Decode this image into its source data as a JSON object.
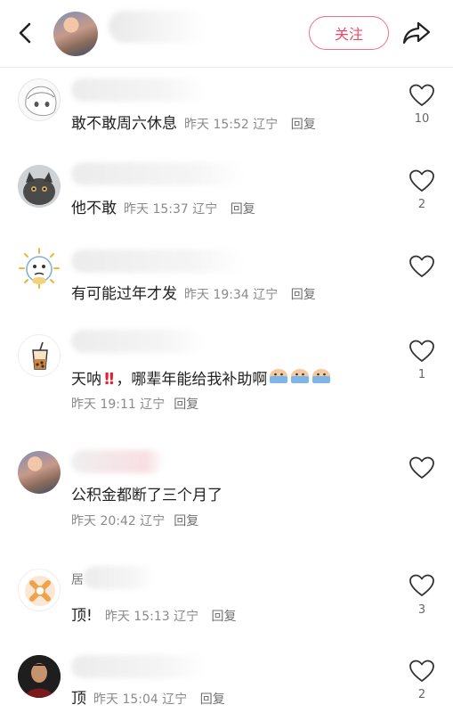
{
  "header": {
    "follow_label": "关注"
  },
  "comments": [
    {
      "text": "敢不敢周六休息",
      "date": "昨天",
      "time": "15:52",
      "location": "辽宁",
      "reply": "回复",
      "likes": "10"
    },
    {
      "text": "他不敢",
      "date": "昨天",
      "time": "15:37",
      "location": "辽宁",
      "reply": "回复",
      "likes": "2"
    },
    {
      "text": "有可能过年才发",
      "date": "昨天",
      "time": "19:34",
      "location": "辽宁",
      "reply": "回复",
      "likes": ""
    },
    {
      "text": "天呐",
      "text_after": "，哪辈年能给我补助啊",
      "date": "昨天",
      "time": "19:11",
      "location": "辽宁",
      "reply": "回复",
      "likes": "1"
    },
    {
      "text": "公积金都断了三个月了",
      "date": "昨天",
      "time": "20:42",
      "location": "辽宁",
      "reply": "回复",
      "likes": ""
    },
    {
      "name_partial": "居",
      "text": "顶!",
      "date": "昨天",
      "time": "15:13",
      "location": "辽宁",
      "reply": "回复",
      "likes": "3"
    },
    {
      "text": "顶",
      "date": "昨天",
      "time": "15:04",
      "location": "辽宁",
      "reply": "回复",
      "likes": "2"
    }
  ],
  "colors": {
    "accent": "#ec4a68",
    "meta_text": "#8a8a8a",
    "exclaim": "#e0212f"
  },
  "icons": {
    "back": "chevron-left-icon",
    "share": "share-arrow-icon",
    "like": "heart-outline-icon",
    "emoji": "crying-face-emoji-icon"
  }
}
